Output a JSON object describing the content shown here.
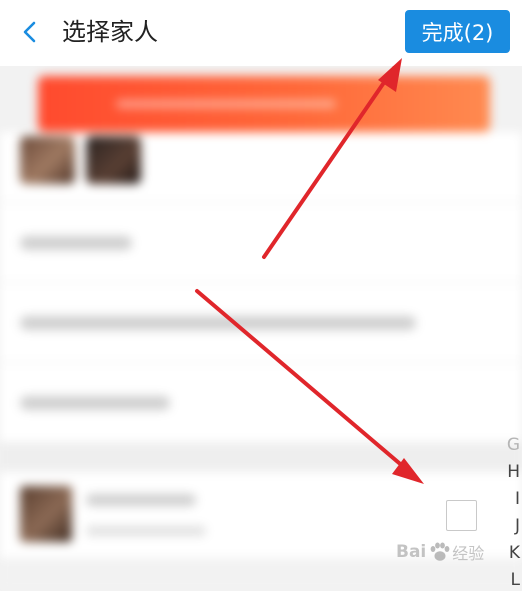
{
  "header": {
    "title": "选择家人",
    "done_label": "完成(2)",
    "accent_color": "#1a8ce0"
  },
  "index_bar": {
    "letters": [
      "G",
      "H",
      "I",
      "J",
      "K",
      "L"
    ]
  },
  "watermark": {
    "brand": "Bai",
    "site": "经验"
  },
  "annotation": {
    "arrow_color": "#e0262b"
  },
  "icons": {
    "back": "chevron-left-icon",
    "checkbox": "checkbox-unchecked"
  }
}
